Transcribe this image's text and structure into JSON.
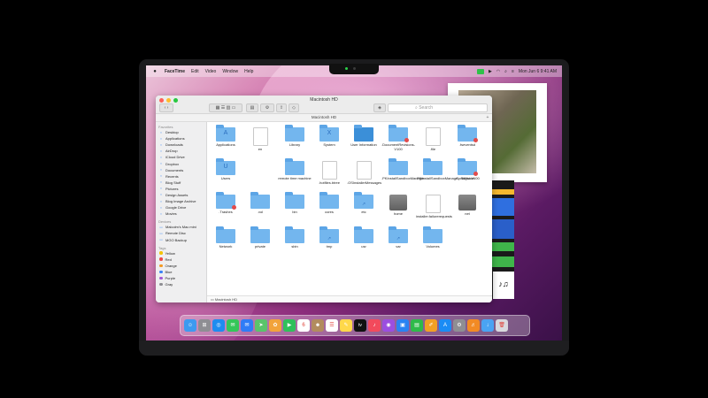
{
  "menubar": {
    "app_name": "FaceTime",
    "items": [
      "Edit",
      "Video",
      "Window",
      "Help"
    ],
    "date_time": "Mon Jun 6  9:41 AM"
  },
  "finder": {
    "window_title": "Macintosh HD",
    "path_title": "Macintosh HD",
    "search_placeholder": "Search",
    "status_path": "Macintosh HD",
    "sidebar": {
      "favorites_header": "Favorites",
      "favorites": [
        "Desktop",
        "Applications",
        "Downloads",
        "AirDrop",
        "iCloud Drive",
        "Dropbox",
        "Documents",
        "Recents",
        "Blog Stuff",
        "Pictures",
        "Design Assets",
        "Blog Image Archive",
        "Google Drive",
        "Movies"
      ],
      "devices_header": "Devices",
      "devices": [
        "Malcolm's Mac mini",
        "Remote Disc",
        "MGO Backup"
      ],
      "tags_header": "Tags",
      "tags": [
        {
          "label": "Yellow",
          "color": "#f5c400"
        },
        {
          "label": "Red",
          "color": "#ef4b47"
        },
        {
          "label": "Orange",
          "color": "#f39a24"
        },
        {
          "label": "Blue",
          "color": "#3b82f6"
        },
        {
          "label": "Purple",
          "color": "#a35bd6"
        },
        {
          "label": "Gray",
          "color": "#8e8e93"
        }
      ]
    },
    "rows": [
      [
        {
          "label": "Applications",
          "kind": "folder",
          "glyph": "A"
        },
        {
          "label": "en",
          "kind": "doc"
        },
        {
          "label": "Library",
          "kind": "folder",
          "glyph": ""
        },
        {
          "label": "System",
          "kind": "folder",
          "glyph": "X"
        },
        {
          "label": "User Information",
          "kind": "folder-dark"
        },
        {
          "label": ".DocumentRevisions-V100",
          "kind": "folder-badge"
        },
        {
          "label": ".file",
          "kind": "doc"
        },
        {
          "label": ".fseventsd",
          "kind": "folder-badge"
        }
      ],
      [
        {
          "label": "Users",
          "kind": "folder",
          "glyph": "U"
        },
        {
          "label": "",
          "kind": "empty"
        },
        {
          "label": "remote time machine",
          "kind": "folder"
        },
        {
          "label": ".hotfiles.btree",
          "kind": "doc"
        },
        {
          "label": ".OSInstallerMessages",
          "kind": "doc"
        },
        {
          "label": ".PKInstallSandboxManager",
          "kind": "folder"
        },
        {
          "label": ".PKInstallSandboxManage...Software",
          "kind": "folder"
        },
        {
          "label": ".Spotlight-V100",
          "kind": "folder-badge"
        }
      ],
      [
        {
          "label": ".Trashes",
          "kind": "folder-badge"
        },
        {
          "label": ".vol",
          "kind": "folder"
        },
        {
          "label": "bin",
          "kind": "folder"
        },
        {
          "label": "cores",
          "kind": "folder"
        },
        {
          "label": "etc",
          "kind": "folder-link"
        },
        {
          "label": "home",
          "kind": "disk"
        },
        {
          "label": "installer.failurerequests",
          "kind": "doc"
        },
        {
          "label": "net",
          "kind": "disk"
        }
      ],
      [
        {
          "label": "Network",
          "kind": "folder"
        },
        {
          "label": "private",
          "kind": "folder"
        },
        {
          "label": "sbin",
          "kind": "folder"
        },
        {
          "label": "tmp",
          "kind": "folder-link"
        },
        {
          "label": "usr",
          "kind": "folder"
        },
        {
          "label": "var",
          "kind": "folder-link"
        },
        {
          "label": "Volumes",
          "kind": "folder"
        }
      ]
    ]
  },
  "dock": {
    "apps": [
      {
        "name": "finder",
        "color": "#3d9af0",
        "glyph": "☺"
      },
      {
        "name": "launchpad",
        "color": "#8e8e93",
        "glyph": "⊞"
      },
      {
        "name": "safari",
        "color": "#1e8cf0",
        "glyph": "◎"
      },
      {
        "name": "messages",
        "color": "#34c759",
        "glyph": "✉"
      },
      {
        "name": "mail",
        "color": "#2f7cf6",
        "glyph": "✉"
      },
      {
        "name": "maps",
        "color": "#5ac46b",
        "glyph": "➤"
      },
      {
        "name": "photos",
        "color": "#f2a33b",
        "glyph": "✿"
      },
      {
        "name": "facetime",
        "color": "#30c05b",
        "glyph": "▶"
      },
      {
        "name": "calendar",
        "color": "#ffffff",
        "glyph": "6"
      },
      {
        "name": "contacts",
        "color": "#b28c5e",
        "glyph": "☻"
      },
      {
        "name": "reminders",
        "color": "#ffffff",
        "glyph": "☰"
      },
      {
        "name": "notes",
        "color": "#ffd84a",
        "glyph": "✎"
      },
      {
        "name": "tv",
        "color": "#111111",
        "glyph": "tv"
      },
      {
        "name": "music",
        "color": "#f24a5c",
        "glyph": "♪"
      },
      {
        "name": "podcasts",
        "color": "#9b4ee0",
        "glyph": "◉"
      },
      {
        "name": "keynote",
        "color": "#2a83f2",
        "glyph": "▣"
      },
      {
        "name": "numbers",
        "color": "#2fba4a",
        "glyph": "▤"
      },
      {
        "name": "pages",
        "color": "#f2a024",
        "glyph": "✐"
      },
      {
        "name": "app-store",
        "color": "#1a8cf5",
        "glyph": "A"
      },
      {
        "name": "system-preferences",
        "color": "#8e8e93",
        "glyph": "⚙"
      },
      {
        "name": "garageband",
        "color": "#f28a24",
        "glyph": "♬"
      },
      {
        "name": "downloads",
        "color": "#4aa3f2",
        "glyph": "↓"
      },
      {
        "name": "trash",
        "color": "#d9d9dd",
        "glyph": "🗑"
      }
    ]
  }
}
